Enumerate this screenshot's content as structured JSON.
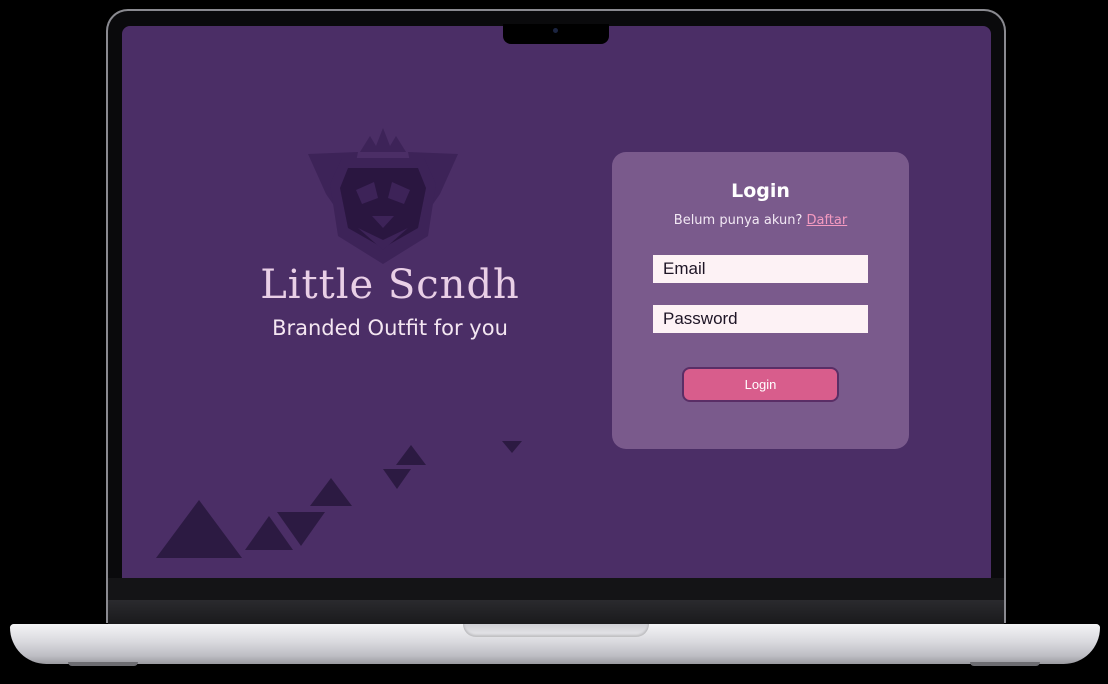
{
  "brand": {
    "title": "Little Scndh",
    "subtitle": "Branded Outfit for you",
    "logo_icon": "lion-crown-crest-icon"
  },
  "login": {
    "title": "Login",
    "register_prompt": "Belum punya akun?",
    "register_link": "Daftar",
    "email_placeholder": "Email",
    "password_placeholder": "Password",
    "submit_label": "Login"
  },
  "colors": {
    "screen_background": "#4b2e66",
    "card_background": "#7a5a8c",
    "button_background": "#d85d8c",
    "link": "#f49ac0",
    "brand_text": "#e9cfe6",
    "decoration": "#2c1a42"
  }
}
